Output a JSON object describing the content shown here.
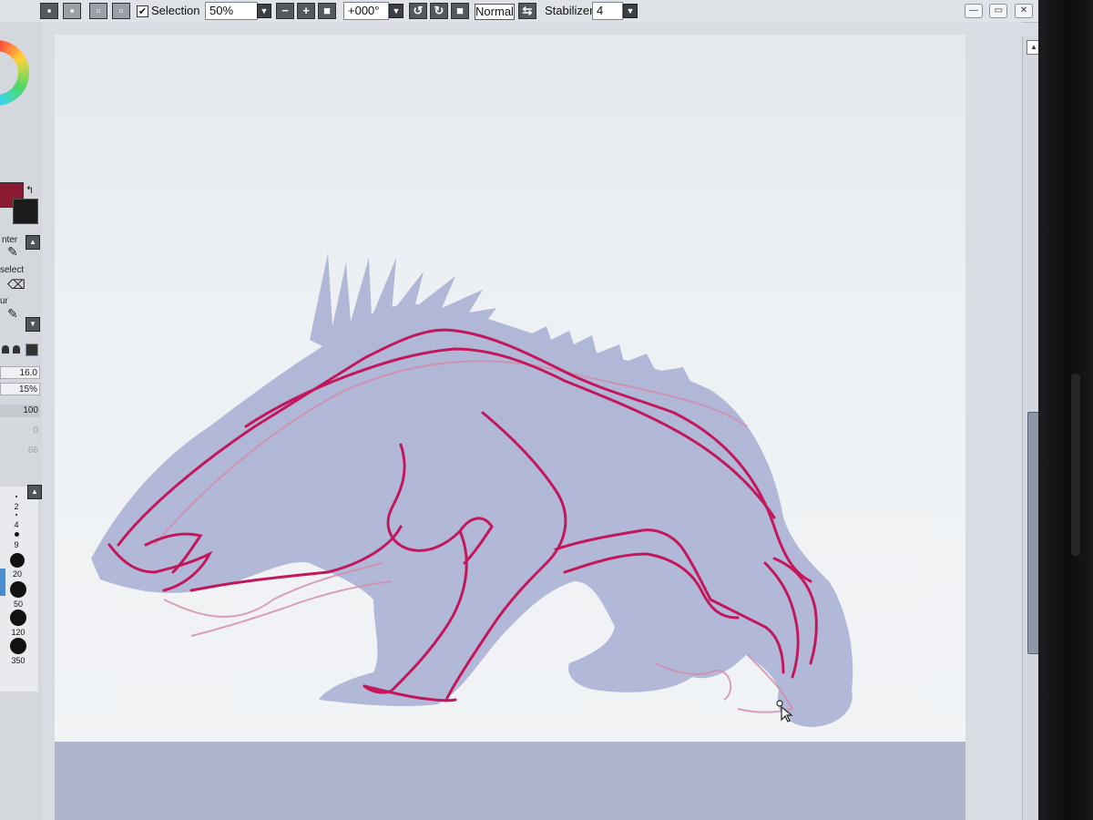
{
  "toolbar": {
    "selection_label": "Selection",
    "zoom_value": "50%",
    "rotation_value": "+000°",
    "blend_mode": "Normal",
    "stabilizer_label": "Stabilizer",
    "stabilizer_value": "4",
    "zoom_out_glyph": "−",
    "zoom_in_glyph": "+",
    "zoom_reset_glyph": "■",
    "rotate_ccw_glyph": "↺",
    "rotate_cw_glyph": "↻",
    "rotate_reset_glyph": "■",
    "flip_glyph": "⇆",
    "dropdown_glyph": "▼",
    "check_glyph": "✔",
    "selection_checked": true
  },
  "window": {
    "minimize": "—",
    "restore": "▭",
    "close": "✕"
  },
  "tool_panel": {
    "tool_labels": [
      "nter",
      "select",
      "ur"
    ],
    "brush_size": "16.0",
    "min_size": "15%",
    "density": "100",
    "faint_values": [
      "0",
      "66"
    ],
    "sizes": [
      "2",
      "4",
      "9",
      "20",
      "50",
      "120",
      "350"
    ],
    "scroll_up": "▲",
    "scroll_down": "▼",
    "swap_glyph": "↰"
  },
  "colors": {
    "foreground": "#8a1a32",
    "background": "#1b1b1b",
    "sketch_stroke": "#c2185b",
    "silhouette": "#a7aed2"
  },
  "scrollbar": {
    "up_glyph": "▲"
  }
}
